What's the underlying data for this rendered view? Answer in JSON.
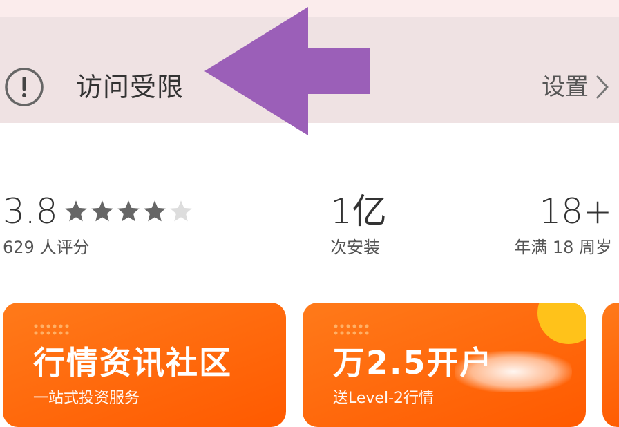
{
  "banner": {
    "title": "访问受限",
    "settings_label": "设置",
    "warning_icon": "exclamation-circle-icon",
    "chevron_icon": "chevron-right-icon",
    "annotation_arrow_color": "#9b5fb8"
  },
  "stats": {
    "rating": {
      "value": "3.8",
      "stars_filled": 4,
      "stars_total": 5,
      "caption": "629 人评分"
    },
    "installs": {
      "value": "1亿",
      "caption": "次安装"
    },
    "age": {
      "value": "18+",
      "caption": "年满 18 周岁"
    }
  },
  "cards": [
    {
      "title": "行情资讯社区",
      "subtitle": "一站式投资服务"
    },
    {
      "title": "万2.5开户",
      "subtitle": "送Level-2行情"
    }
  ],
  "colors": {
    "banner_bg": "#efe2e3",
    "card_orange": "#ff6a0a",
    "star_gray": "#666666",
    "star_empty": "#dddddd"
  }
}
